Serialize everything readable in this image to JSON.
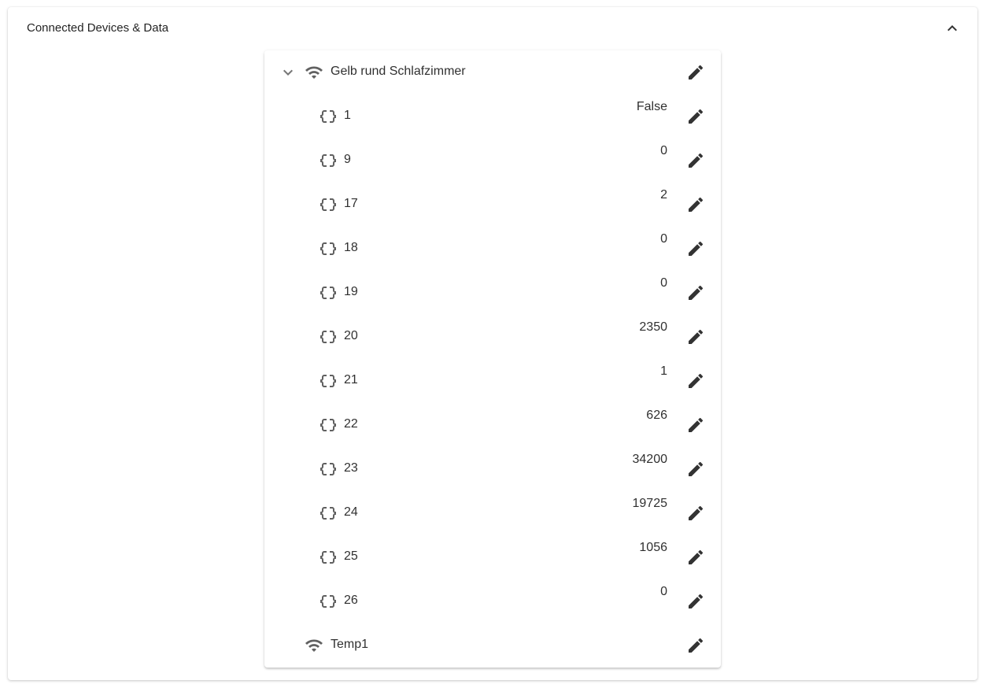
{
  "panel": {
    "title": "Connected Devices & Data",
    "collapse_icon": "chevron-up-icon"
  },
  "devices": [
    {
      "name": "Gelb rund Schlafzimmer",
      "icon": "wifi-icon",
      "expanded": true,
      "datapoints": [
        {
          "key": "1",
          "value": "False"
        },
        {
          "key": "9",
          "value": "0"
        },
        {
          "key": "17",
          "value": "2"
        },
        {
          "key": "18",
          "value": "0"
        },
        {
          "key": "19",
          "value": "0"
        },
        {
          "key": "20",
          "value": "2350"
        },
        {
          "key": "21",
          "value": "1"
        },
        {
          "key": "22",
          "value": "626"
        },
        {
          "key": "23",
          "value": "34200"
        },
        {
          "key": "24",
          "value": "19725"
        },
        {
          "key": "25",
          "value": "1056"
        },
        {
          "key": "26",
          "value": "0"
        }
      ]
    },
    {
      "name": "Temp1",
      "icon": "wifi-icon",
      "expanded": false,
      "datapoints": []
    }
  ]
}
